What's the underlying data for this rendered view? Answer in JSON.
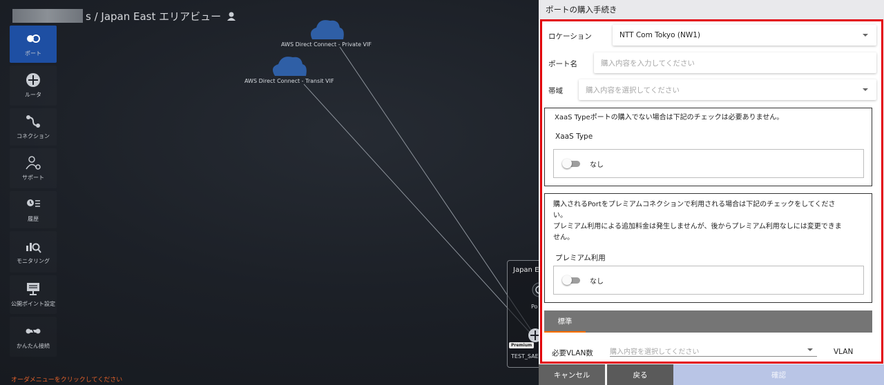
{
  "header": {
    "title_suffix": "s / Japan East エリアビュー"
  },
  "sidebar": {
    "items": [
      {
        "label": "ポート",
        "icon": "port-icon",
        "active": true
      },
      {
        "label": "ルータ",
        "icon": "router-icon"
      },
      {
        "label": "コネクション",
        "icon": "connection-icon"
      },
      {
        "label": "サポート",
        "icon": "support-icon"
      },
      {
        "label": "履歴",
        "icon": "history-icon"
      },
      {
        "label": "モニタリング",
        "icon": "monitoring-icon"
      },
      {
        "label": "公開ポイント設定",
        "icon": "public-point-icon"
      },
      {
        "label": "かんたん接続",
        "icon": "easy-connect-icon"
      }
    ]
  },
  "canvas": {
    "clouds": [
      {
        "label": "AWS Direct Connect - Private VIF"
      },
      {
        "label": "AWS Direct Connect - Transit VIF"
      }
    ],
    "area_box": {
      "label": "Japan E",
      "port_label": "Po",
      "premium_badge": "Premium",
      "node_label": "TEST_SAE"
    },
    "footer_hint": "オーダメニューをクリックしてください"
  },
  "panel": {
    "title": "ポートの購入手続き",
    "location": {
      "label": "ロケーション",
      "value": "NTT Com Tokyo (NW1)"
    },
    "port_name": {
      "label": "ポート名",
      "placeholder": "購入内容を入力してください"
    },
    "bandwidth": {
      "label": "帯域",
      "placeholder": "購入内容を選択してください"
    },
    "xaas": {
      "notice": "XaaS Typeポートの購入でない場合は下記のチェックは必要ありません。",
      "heading": "XaaS Type",
      "toggle_text": "なし"
    },
    "premium": {
      "notice_line1": "購入されるPortをプレミアムコネクションで利用される場合は下記のチェックをしてくださ",
      "notice_line2": "い。",
      "notice_line3": "プレミアム利用による追加料金は発生しませんが、後からプレミアム利用なしには変更できま",
      "notice_line4": "せん。",
      "heading": "プレミアム利用",
      "toggle_text": "なし"
    },
    "tab_label": "標準",
    "vlan": {
      "label": "必要VLAN数",
      "placeholder": "購入内容を選択してください",
      "unit": "VLAN"
    },
    "buttons": {
      "cancel": "キャンセル",
      "back": "戻る",
      "confirm": "確認"
    }
  },
  "colors": {
    "highlight_frame": "#e3000b",
    "active_sidebar": "#1e4fa3",
    "hint_text": "#e0602a",
    "tab_underline": "#ff6d00",
    "confirm_button": "#b9c5e6"
  }
}
